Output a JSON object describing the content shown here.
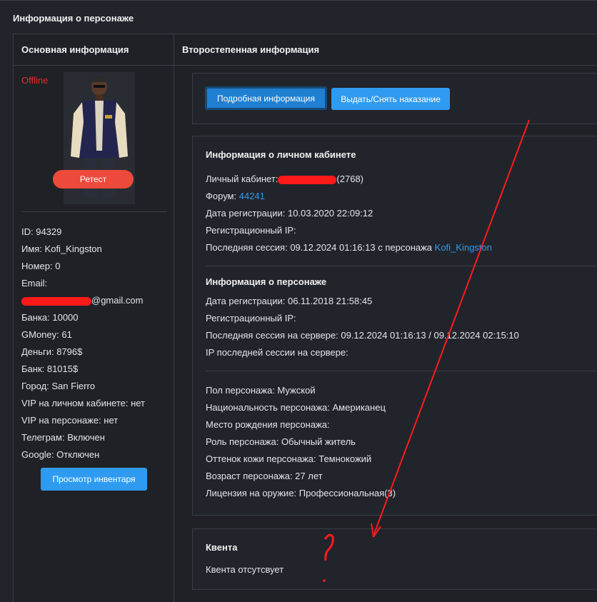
{
  "page_title": "Информация о персонаже",
  "left": {
    "header": "Основная информация",
    "status": "Offline",
    "reset_label": "Ретест",
    "info": [
      {
        "key": "id",
        "text": "ID: 94329"
      },
      {
        "key": "name",
        "text": "Имя: Kofi_Kingston"
      },
      {
        "key": "number",
        "text": "Номер: 0"
      },
      {
        "key": "email_label",
        "text": "Email:"
      },
      {
        "key": "email_value",
        "text": "@gmail.com"
      },
      {
        "key": "bank_a",
        "text": "Банка: 10000"
      },
      {
        "key": "gmoney",
        "text": "GMoney: 61"
      },
      {
        "key": "money",
        "text": "Деньги: 8796$"
      },
      {
        "key": "bank",
        "text": "Банк: 81015$"
      },
      {
        "key": "city",
        "text": "Город: San Fierro"
      },
      {
        "key": "vip_cabinet",
        "text": "VIP на личном кабинете: нет"
      },
      {
        "key": "vip_char",
        "text": "VIP на персонаже: нет"
      },
      {
        "key": "telegram",
        "text": "Телеграм: Включен"
      },
      {
        "key": "google",
        "text": "Google: Отключен"
      }
    ],
    "inventory_label": "Просмотр инвентаря"
  },
  "right": {
    "header": "Второстепенная информация",
    "btn_details": "Подробная информация",
    "btn_punish": "Выдать/Снять наказание",
    "cabinet": {
      "title": "Информация о личном кабинете",
      "personal_label": "Личный кабинет:",
      "personal_suffix": "(2768)",
      "forum_label": "Форум:",
      "forum_link": "44241",
      "reg_date": "Дата регистрации: 10.03.2020 22:09:12",
      "reg_ip": "Регистрационный IP:",
      "last_session_prefix": "Последняя сессия: 09.12.2024 01:16:13 с персонажа",
      "last_session_link": "Kofi_Kingston"
    },
    "character": {
      "title": "Информация о персонаже",
      "reg_date": "Дата регистрации: 06.11.2018 21:58:45",
      "reg_ip": "Регистрационный IP:",
      "last_session": "Последняя сессия на сервере: 09.12.2024 01:16:13 / 09.12.2024 02:15:10",
      "last_ip": "IP последней сессии на сервере:"
    },
    "details": [
      "Пол персонажа: Мужской",
      "Национальность персонажа: Американец",
      "Место рождения персонажа:",
      "Роль персонажа: Обычный житель",
      "Оттенок кожи персонажа: Темнокожий",
      "Возраст персонажа: 27 лет",
      "Лицензия на оружие: Профессиональная(3)"
    ],
    "kventa": {
      "title": "Квента",
      "text": "Квента отсутсвует"
    }
  },
  "annotation": {
    "mark": "?",
    "color": "#ff1a1a"
  }
}
